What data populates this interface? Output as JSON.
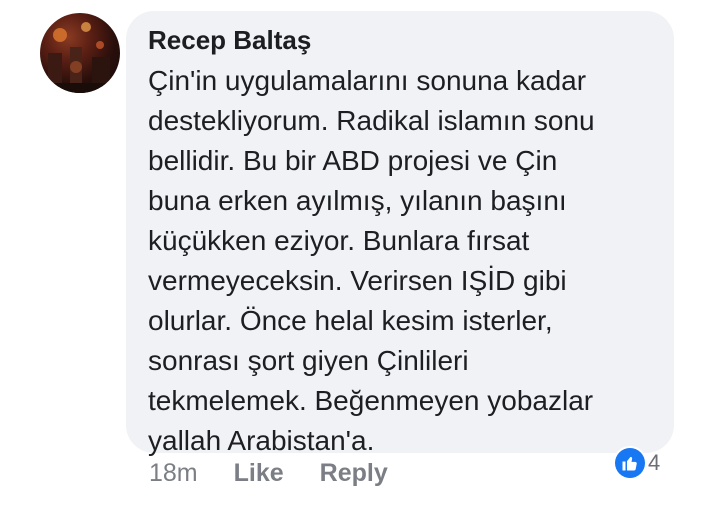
{
  "comment": {
    "author": "Recep Baltaş",
    "text_lines": [
      "Çin'in uygulamalarını sonuna kadar",
      "destekliyorum. Radikal islamın sonu",
      "bellidir. Bu bir ABD projesi ve Çin",
      "buna erken ayılmış, yılanın başını",
      "küçükken eziyor. Bunlara fırsat",
      "vermeyeceksin. Verirsen IŞİD gibi",
      "olurlar. Önce helal kesim isterler,",
      "sonrası şort giyen Çinlileri",
      "tekmelemek. Beğenmeyen yobazlar",
      "yallah Arabistan'a."
    ],
    "time": "18m",
    "like_label": "Like",
    "reply_label": "Reply",
    "reaction_count": "4",
    "reaction_icon": "thumbs-up-icon",
    "bubble_color": "#f0f2f5",
    "reaction_color": "#1877f2"
  }
}
